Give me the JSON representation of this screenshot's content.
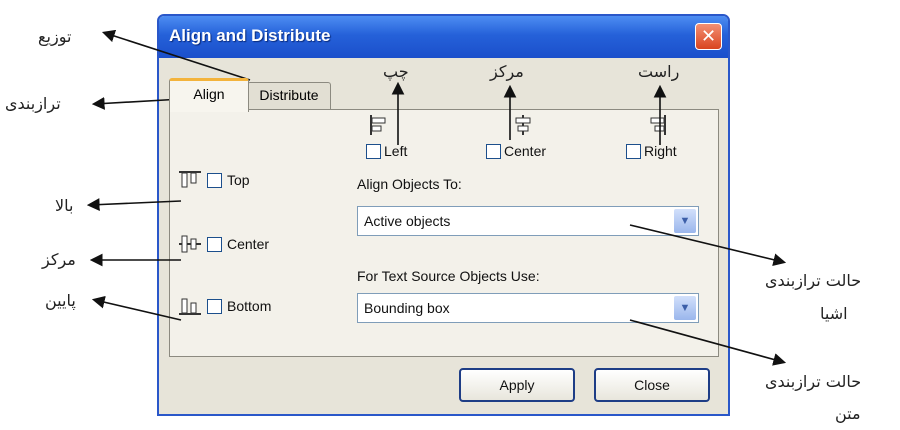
{
  "dialog": {
    "title": "Align and Distribute",
    "close_glyph": "✕",
    "tabs": [
      {
        "label": "Align"
      },
      {
        "label": "Distribute"
      }
    ],
    "horizontal": [
      {
        "label": "Left",
        "icon": "align-left-icon"
      },
      {
        "label": "Center",
        "icon": "align-center-h-icon"
      },
      {
        "label": "Right",
        "icon": "align-right-icon"
      }
    ],
    "vertical": [
      {
        "label": "Top",
        "icon": "align-top-icon"
      },
      {
        "label": "Center",
        "icon": "align-center-v-icon"
      },
      {
        "label": "Bottom",
        "icon": "align-bottom-icon"
      }
    ],
    "align_objects_to": {
      "label": "Align Objects To:",
      "value": "Active objects"
    },
    "text_source": {
      "label": "For Text Source Objects Use:",
      "value": "Bounding box"
    },
    "buttons": {
      "apply": "Apply",
      "close": "Close"
    }
  },
  "annotations": {
    "distribute": "توزیع",
    "align_tab": "ترازبندی",
    "top": "بالا",
    "center_v": "مرکز",
    "bottom": "پایین",
    "left": "چپ",
    "center_h": "مرکز",
    "right": "راست",
    "objects_mode": [
      "حالت ترازبندی",
      "اشیا"
    ],
    "text_mode": [
      "حالت ترازبندی",
      "متن"
    ]
  },
  "colors": {
    "titlebar": "#2561d9",
    "dialog_bg": "#e7e4d9",
    "accent_tab": "#f3b33c"
  }
}
